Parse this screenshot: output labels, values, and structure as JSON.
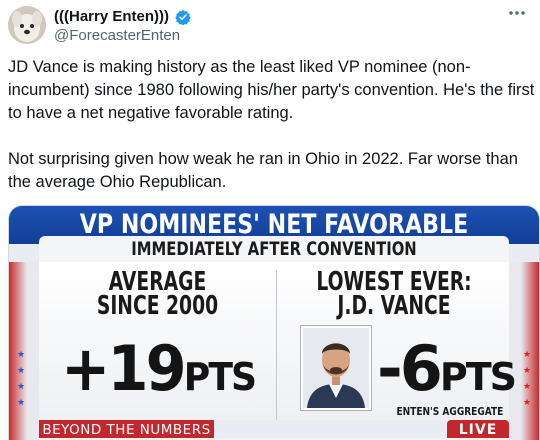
{
  "tweet": {
    "display_name": "(((Harry Enten)))",
    "handle": "@ForecasterEnten",
    "verified_icon": "verified-badge-icon",
    "more_icon": "more-options-icon",
    "paragraphs": [
      "JD Vance is making history as the least liked VP nominee (non-incumbent) since 1980 following his/her party's convention. He's the first to have a net negative favorable rating.",
      "Not surprising given how weak he ran in Ohio in 2022. Far worse than the average Ohio Republican."
    ]
  },
  "graphic": {
    "title": "VP NOMINEES' NET FAVORABLE RATING",
    "subtitle": "IMMEDIATELY AFTER CONVENTION",
    "left_heading_1": "AVERAGE",
    "left_heading_2": "SINCE 2000",
    "left_value": "+19",
    "left_unit": "PTS",
    "right_heading_1": "LOWEST EVER:",
    "right_heading_2": "J.D. VANCE",
    "right_value": "-6",
    "right_unit": "PTS",
    "source": "ENTEN'S AGGREGATE",
    "bottom_label": "BEYOND THE NUMBERS",
    "live_label": "LIVE"
  },
  "colors": {
    "banner_blue": "#1a4fb0",
    "accent_red": "#c1272d",
    "verified_blue": "#1d9bf0",
    "muted_text": "#536471"
  }
}
